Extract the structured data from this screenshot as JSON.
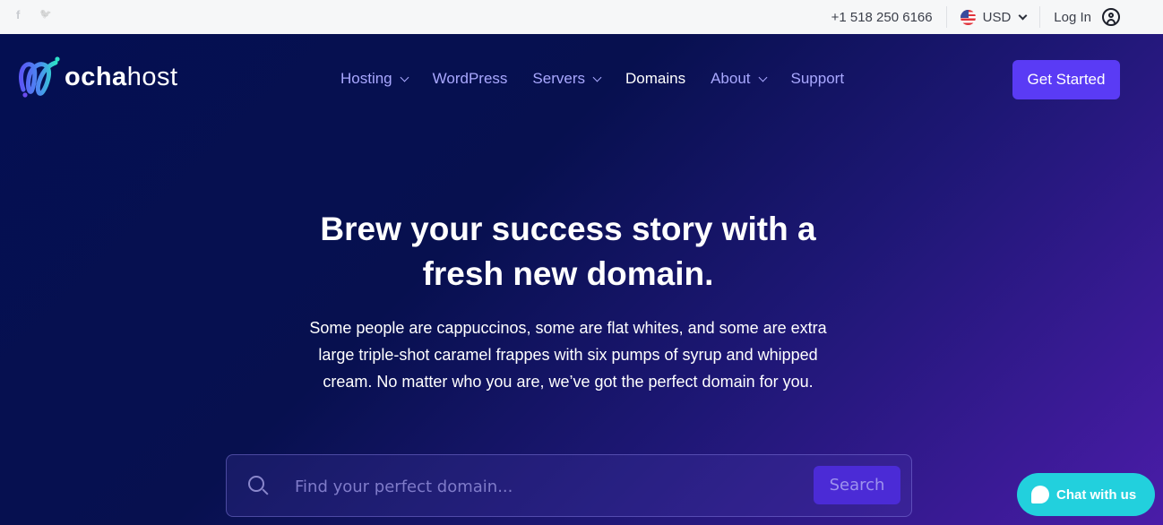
{
  "topbar": {
    "social": [
      {
        "icon": "facebook-icon",
        "glyph": "f"
      },
      {
        "icon": "twitter-icon",
        "glyph": "🐦"
      }
    ],
    "phone": "+1 518 250 6166",
    "currency": "USD",
    "login": "Log In"
  },
  "brand": {
    "logo_bold": "ocha",
    "logo_light": "host",
    "colors": {
      "accent": "#5a3bf5",
      "chat": "#22d0dd",
      "nav": "#a9a8ff",
      "bg_dark": "#040f52",
      "bg_purple": "#4a1ca8"
    }
  },
  "nav": {
    "items": [
      {
        "label": "Hosting",
        "dropdown": true,
        "active": false
      },
      {
        "label": "WordPress",
        "dropdown": false,
        "active": false
      },
      {
        "label": "Servers",
        "dropdown": true,
        "active": false
      },
      {
        "label": "Domains",
        "dropdown": false,
        "active": true
      },
      {
        "label": "About",
        "dropdown": true,
        "active": false
      },
      {
        "label": "Support",
        "dropdown": false,
        "active": false
      }
    ],
    "cta": "Get Started"
  },
  "hero": {
    "headline_bold": "Brew your success story",
    "headline_rest": " with a",
    "headline_line2": "fresh new domain.",
    "sub_line1": "Some people are cappuccinos, some are flat whites, and some are extra",
    "sub_line2": "large triple-shot caramel frappes with six pumps of syrup and whipped",
    "sub_line3": "cream. No matter who you are, we’ve got the perfect domain for you."
  },
  "search": {
    "placeholder": "Find your perfect domain...",
    "value": "",
    "button": "Search"
  },
  "chat": {
    "label": "Chat with us"
  }
}
